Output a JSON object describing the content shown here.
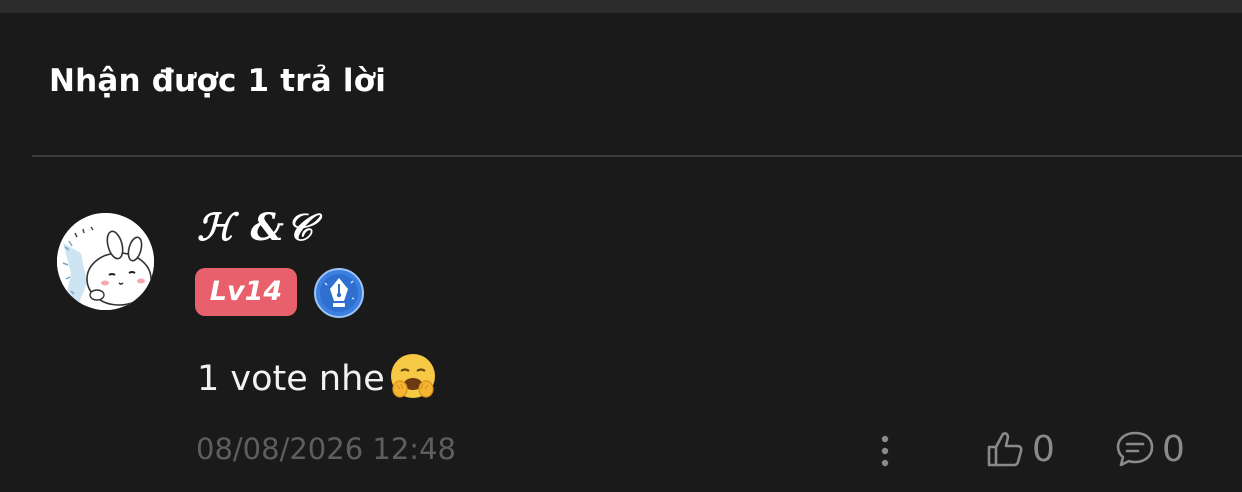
{
  "header": {
    "title": "Nhận được 1 trả lời"
  },
  "reply": {
    "username": "ℋ &𝒞",
    "level": "Lv14",
    "text": "1 vote nhe",
    "timestamp": "08/08/2026 12:48",
    "likes": "0",
    "replies": "0"
  },
  "icons": {
    "avatar": "bunny-avatar",
    "writer_badge": "pen-nib-icon",
    "emoji": "hugging-face-emoji",
    "more": "vertical-dots-icon",
    "like": "thumbs-up-icon",
    "reply": "comment-bubble-icon"
  },
  "colors": {
    "background": "#1a1a1a",
    "level_badge": "#e8606c",
    "writer_badge": "#3b7fe0",
    "muted_text": "#5e5e5e",
    "action_gray": "#8a8a8a"
  }
}
